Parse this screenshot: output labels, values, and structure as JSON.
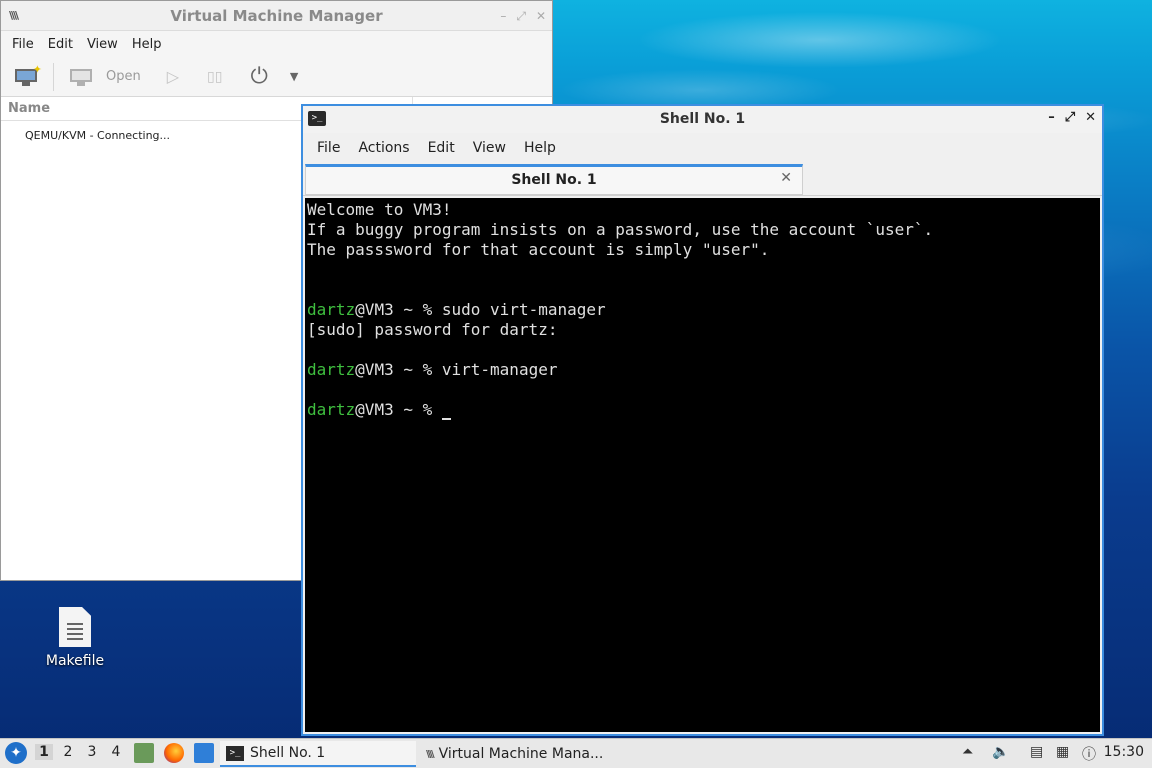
{
  "vmm": {
    "title": "Virtual Machine Manager",
    "menu": [
      "File",
      "Edit",
      "View",
      "Help"
    ],
    "toolbar": {
      "open_label": "Open"
    },
    "list": {
      "header": "Name",
      "rows": [
        "QEMU/KVM - Connecting..."
      ]
    }
  },
  "shell": {
    "title": "Shell No. 1",
    "menu": [
      "File",
      "Actions",
      "Edit",
      "View",
      "Help"
    ],
    "tab_label": "Shell No. 1",
    "terminal": {
      "welcome": [
        "Welcome to VM3!",
        "If a buggy program insists on a password, use the account `user`.",
        "The passsword for that account is simply \"user\"."
      ],
      "prompt_user": "dartz",
      "prompt_rest": "@VM3 ~ % ",
      "cmd1": "sudo virt-manager",
      "sudo_line": "[sudo] password for dartz:",
      "cmd2": "virt-manager"
    }
  },
  "desktop": {
    "icon_label": "Makefile"
  },
  "taskbar": {
    "workspaces": [
      "1",
      "2",
      "3",
      "4"
    ],
    "tasks": [
      "Shell No. 1",
      "Virtual Machine Mana..."
    ],
    "clock": "15:30"
  },
  "colors": {
    "accent": "#3d8ee0",
    "prompt_green": "#3fbf3f"
  }
}
